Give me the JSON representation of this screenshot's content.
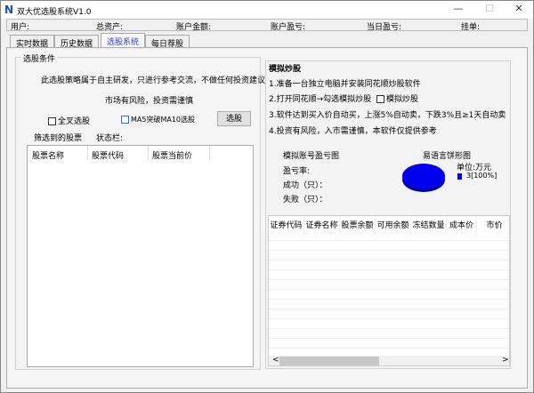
{
  "window": {
    "title": "双大优选股系统V1.0",
    "logo": "N",
    "minimize": "—",
    "maximize": "☐",
    "close": "✕"
  },
  "statusbar": [
    {
      "label": "用户:"
    },
    {
      "label": "总资产:"
    },
    {
      "label": "账户金额:"
    },
    {
      "label": "账户盈亏:"
    },
    {
      "label": "当日盈亏:"
    },
    {
      "label": "挂单:"
    }
  ],
  "tabs": [
    {
      "label": "实时数据"
    },
    {
      "label": "历史数据"
    },
    {
      "label": "选股系统",
      "active": true
    },
    {
      "label": "每日荐股"
    }
  ],
  "left": {
    "group_title": "选股条件",
    "disclaimer": "此选股策略属于自主研发，只进行参考交流，不做任何投资建议",
    "risk": "市场有风险，投资需谨慎",
    "cb_cross": "全叉选股",
    "cb_ma": "MA5突破MA10选股",
    "select_button": "选股",
    "filtered_label": "筛选到的股票",
    "status_label": "状态栏:",
    "columns": [
      "股票名称",
      "股票代码",
      "股票当前价"
    ]
  },
  "right": {
    "group_title": "模拟炒股",
    "steps": [
      "1.准备一台独立电脑并安装同花顺炒股软件",
      "2.打开同花顺→勾选模拟炒股",
      "3.软件达到买入价自动买，上涨5%自动卖，下跌3%且≥1天自动卖",
      "4.投资有风险，入市需谨慎，本软件仅提供参考"
    ],
    "cb_sim": "模拟炒股",
    "chart_title_left": "模拟账号盈亏图",
    "profit_rate": "盈亏率:",
    "success": "成功（只）：",
    "fail": "失败（只）：",
    "pie": {
      "title": "易语言饼形图",
      "unit": "单位:万元",
      "legend": "3[100%]",
      "color": "#0000ee",
      "value": 3,
      "percent": 100
    },
    "columns": [
      "证券代码",
      "证券名称",
      "股票余额",
      "可用余额",
      "冻结数量",
      "成本价",
      "市价"
    ],
    "scroll_left": "<",
    "scroll_right": ">"
  }
}
